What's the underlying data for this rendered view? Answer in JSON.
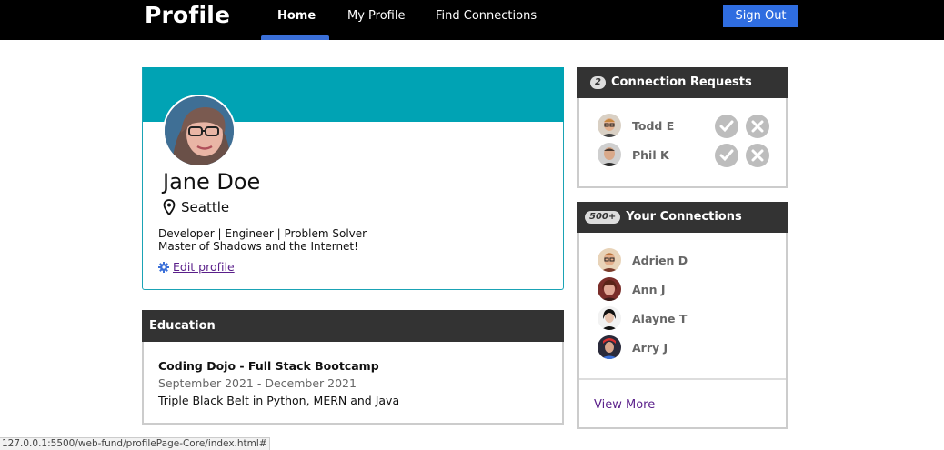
{
  "nav": {
    "brand": "Profile",
    "links": [
      "Home",
      "My Profile",
      "Find Connections"
    ],
    "signout": "Sign Out"
  },
  "profile": {
    "name": "Jane Doe",
    "location": "Seattle",
    "bio_line1": "Developer | Engineer | Problem Solver",
    "bio_line2": "Master of Shadows and the Internet!",
    "edit_label": "Edit profile"
  },
  "education": {
    "header": "Education",
    "school": "Coding Dojo - Full Stack Bootcamp",
    "dates": "September 2021 - December 2021",
    "description": "Triple Black Belt in Python, MERN and Java"
  },
  "requests": {
    "count": "2",
    "title": "Connection Requests",
    "people": [
      "Todd E",
      "Phil K"
    ]
  },
  "connections": {
    "count": "500+",
    "title": "Your Connections",
    "people": [
      "Adrien D",
      "Ann J",
      "Alayne T",
      "Arry J"
    ],
    "view_more": "View More"
  },
  "status_url": "127.0.0.1:5500/web-fund/profilePage-Core/index.html#",
  "colors": {
    "nav_bg": "#000000",
    "accent_blue": "#2f6de0",
    "cover_teal": "#00a3b4",
    "card_header": "#333333",
    "link_purple": "#5a1f8a"
  }
}
